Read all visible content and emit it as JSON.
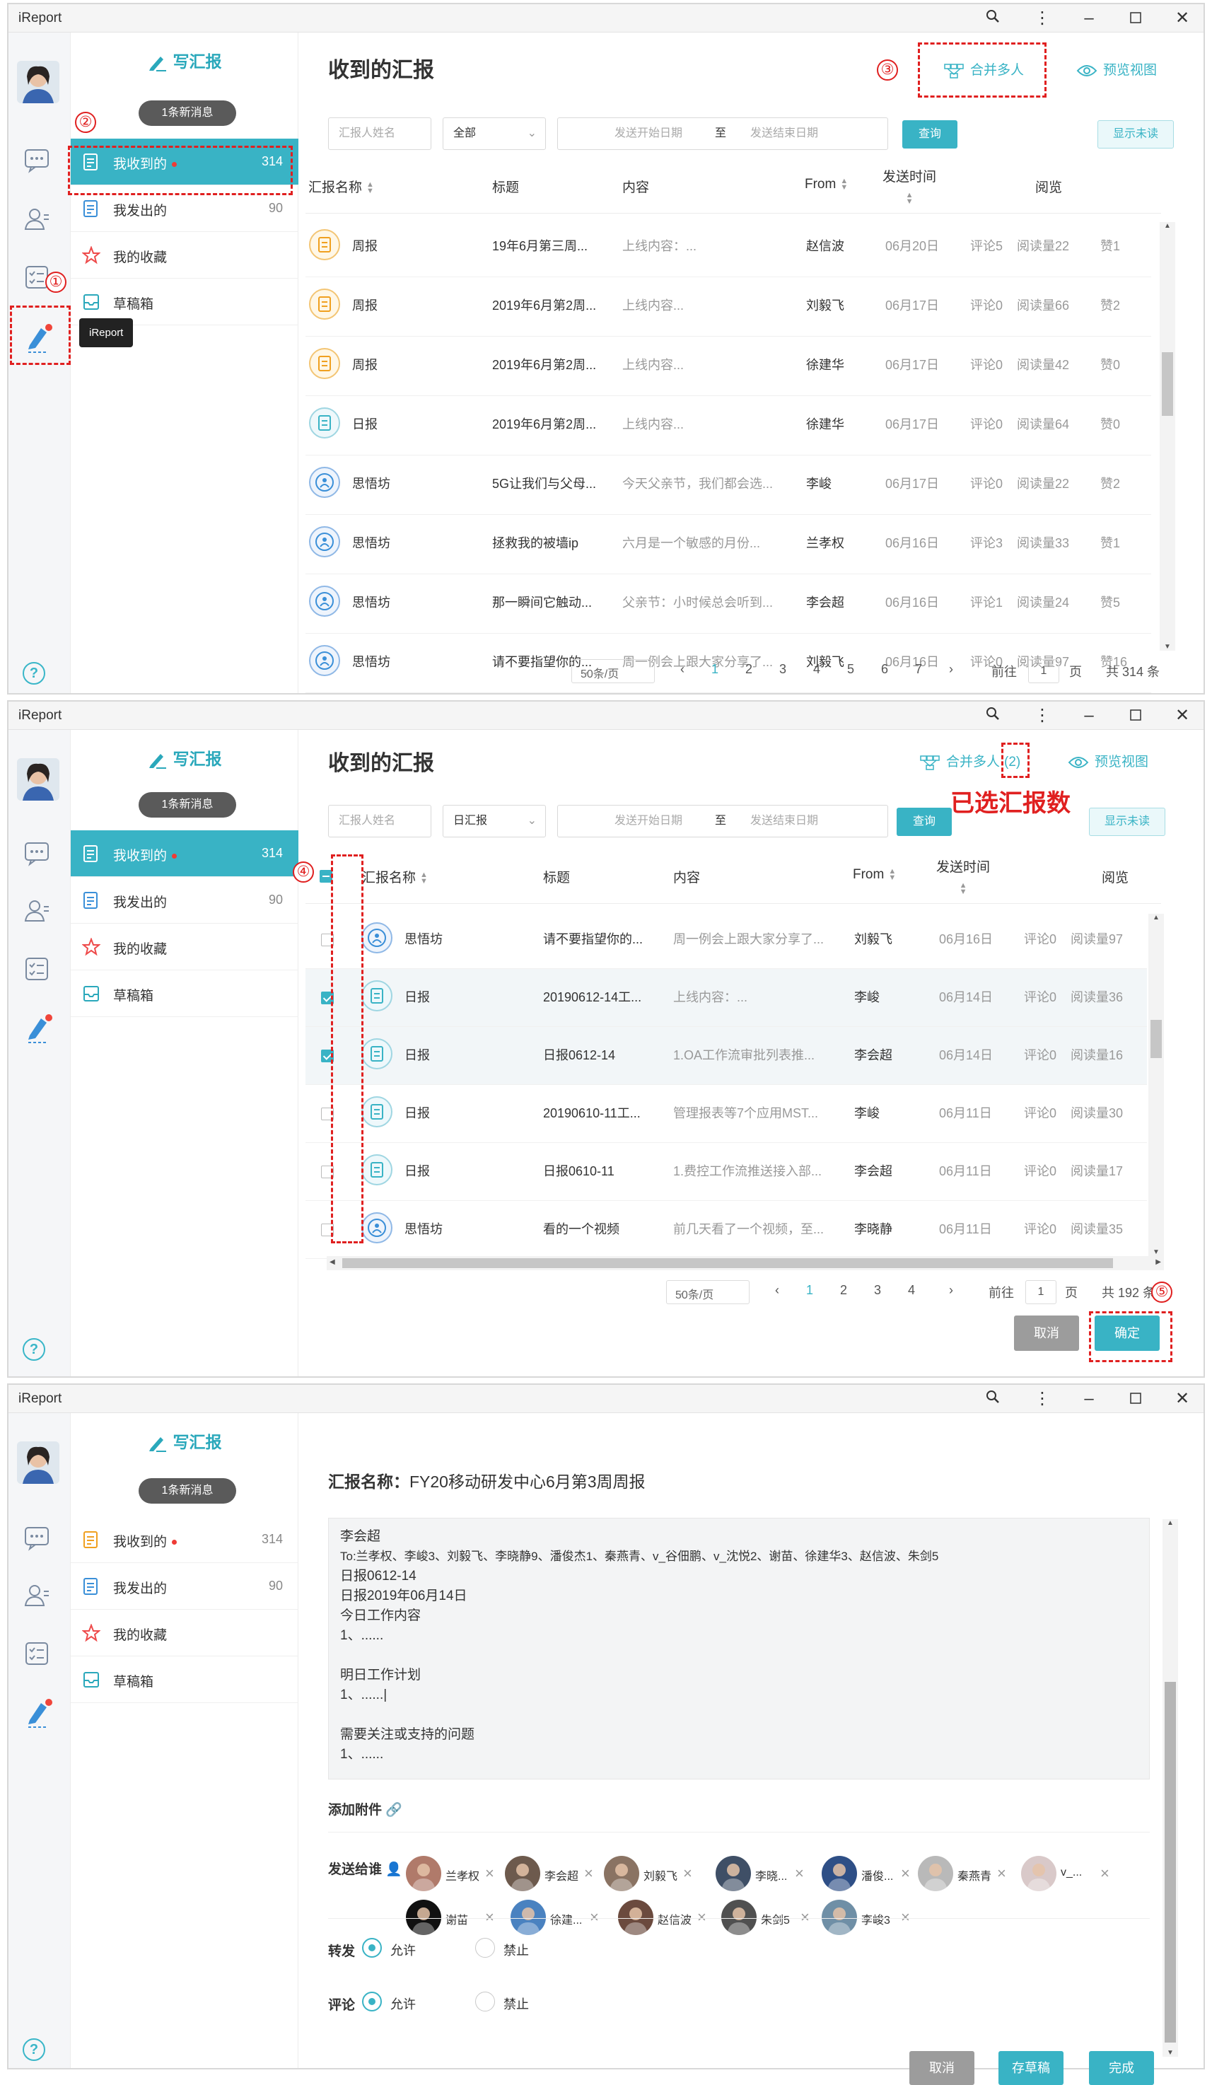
{
  "app": {
    "title": "iReport"
  },
  "sidebar": {
    "write_label": "写汇报",
    "new_msg": "1条新消息",
    "items": [
      {
        "label": "我收到的",
        "count": "314"
      },
      {
        "label": "我发出的",
        "count": "90"
      },
      {
        "label": "我的收藏"
      },
      {
        "label": "草稿箱"
      }
    ]
  },
  "tooltip": "iReport",
  "icons": {
    "chat": "chat-bubble-icon",
    "contacts": "contacts-icon",
    "tasks": "task-list-icon",
    "report": "pen-icon",
    "help": "?"
  },
  "main": {
    "title": "收到的汇报",
    "merge_label": "合并多人",
    "merge_count": "(2)",
    "preview_label": "预览视图",
    "filter": {
      "name_placeholder": "汇报人姓名",
      "type_all": "全部",
      "type_daily": "日汇报",
      "date_start": "发送开始日期",
      "date_to": "至",
      "date_end": "发送结束日期",
      "query": "查询",
      "unread": "显示未读"
    },
    "columns": {
      "name": "汇报名称",
      "title": "标题",
      "content": "内容",
      "from": "From",
      "time1": "发送时间",
      "read": "阅览"
    }
  },
  "table1": [
    {
      "type": "周报",
      "icon": "weekly",
      "title": "19年6月第三周...",
      "content": "上线内容：...",
      "from": "赵信波",
      "date": "06月20日",
      "cmt": "评论5",
      "views": "阅读量22",
      "likes": "赞1"
    },
    {
      "type": "周报",
      "icon": "weekly",
      "title": "2019年6月第2周...",
      "content": "上线内容...",
      "from": "刘毅飞",
      "date": "06月17日",
      "cmt": "评论0",
      "views": "阅读量66",
      "likes": "赞2"
    },
    {
      "type": "周报",
      "icon": "weekly",
      "title": "2019年6月第2周...",
      "content": "上线内容...",
      "from": "徐建华",
      "date": "06月17日",
      "cmt": "评论0",
      "views": "阅读量42",
      "likes": "赞0"
    },
    {
      "type": "日报",
      "icon": "daily",
      "title": "2019年6月第2周...",
      "content": "上线内容...",
      "from": "徐建华",
      "date": "06月17日",
      "cmt": "评论0",
      "views": "阅读量64",
      "likes": "赞0"
    },
    {
      "type": "思悟坊",
      "icon": "think",
      "title": "5G让我们与父母...",
      "content": "今天父亲节，我们都会选...",
      "from": "李峻",
      "date": "06月17日",
      "cmt": "评论0",
      "views": "阅读量22",
      "likes": "赞2"
    },
    {
      "type": "思悟坊",
      "icon": "think",
      "title": "拯救我的被墙ip",
      "content": "六月是一个敏感的月份...",
      "from": "兰孝权",
      "date": "06月16日",
      "cmt": "评论3",
      "views": "阅读量33",
      "likes": "赞1"
    },
    {
      "type": "思悟坊",
      "icon": "think",
      "title": "那一瞬间它触动...",
      "content": "父亲节：小时候总会听到...",
      "from": "李会超",
      "date": "06月16日",
      "cmt": "评论1",
      "views": "阅读量24",
      "likes": "赞5"
    },
    {
      "type": "思悟坊",
      "icon": "think",
      "title": "请不要指望你的...",
      "content": "周一例会上跟大家分享了...",
      "from": "刘毅飞",
      "date": "06月16日",
      "cmt": "评论0",
      "views": "阅读量97",
      "likes": "赞16"
    }
  ],
  "table2": [
    {
      "type": "思悟坊",
      "icon": "think",
      "title": "请不要指望你的...",
      "content": "周一例会上跟大家分享了...",
      "from": "刘毅飞",
      "date": "06月16日",
      "cmt": "评论0",
      "views": "阅读量97",
      "checked": false
    },
    {
      "type": "日报",
      "icon": "daily",
      "title": "20190612-14工...",
      "content": "上线内容：...",
      "from": "李峻",
      "date": "06月14日",
      "cmt": "评论0",
      "views": "阅读量36",
      "checked": true
    },
    {
      "type": "日报",
      "icon": "daily",
      "title": "日报0612-14",
      "content": "1.OA工作流审批列表推...",
      "from": "李会超",
      "date": "06月14日",
      "cmt": "评论0",
      "views": "阅读量16",
      "checked": true
    },
    {
      "type": "日报",
      "icon": "daily",
      "title": "20190610-11工...",
      "content": "管理报表等7个应用MST...",
      "from": "李峻",
      "date": "06月11日",
      "cmt": "评论0",
      "views": "阅读量30",
      "checked": false
    },
    {
      "type": "日报",
      "icon": "daily",
      "title": "日报0610-11",
      "content": "1.费控工作流推送接入部...",
      "from": "李会超",
      "date": "06月11日",
      "cmt": "评论0",
      "views": "阅读量17",
      "checked": false
    },
    {
      "type": "思悟坊",
      "icon": "think",
      "title": "看的一个视频",
      "content": "前几天看了一个视频，至...",
      "from": "李晓静",
      "date": "06月11日",
      "cmt": "评论0",
      "views": "阅读量35",
      "checked": false
    }
  ],
  "pager1": {
    "size": "50条/页",
    "pages": [
      "1",
      "2",
      "3",
      "4",
      "5",
      "6",
      "7"
    ],
    "goto": "前往",
    "page": "1",
    "unit": "页",
    "total": "共 314 条",
    "prev": "‹",
    "next": "›"
  },
  "pager2": {
    "size": "50条/页",
    "pages": [
      "1",
      "2",
      "3",
      "4"
    ],
    "goto": "前往",
    "page": "1",
    "unit": "页",
    "total": "共 192 条",
    "prev": "‹",
    "next": "›"
  },
  "actions": {
    "cancel": "取消",
    "confirm": "确定",
    "draft": "存草稿",
    "done": "完成"
  },
  "annotations": {
    "n1": "①",
    "n2": "②",
    "n3": "③",
    "n4": "④",
    "n5": "⑤",
    "selected": "已选汇报数"
  },
  "compose": {
    "name_label": "汇报名称：",
    "name_value": "FY20移动研发中心6月第3周周报",
    "body": [
      "李会超",
      "To:兰孝权、李峻3、刘毅飞、李晓静9、潘俊杰1、秦燕青、v_谷佃鹏、v_沈悦2、谢苗、徐建华3、赵信波、朱剑5",
      "日报0612-14",
      "日报2019年06月14日",
      "今日工作内容",
      "1、......",
      "",
      "明日工作计划",
      "1、......|",
      "",
      "需要关注或支持的问题",
      "1、......"
    ],
    "attach_label": "添加附件",
    "send_label": "发送给谁",
    "recipients": [
      {
        "name": "兰孝权",
        "color": "#b07a6a"
      },
      {
        "name": "李会超",
        "color": "#6d5a4d"
      },
      {
        "name": "刘毅飞",
        "color": "#8a7363"
      },
      {
        "name": "李晓...",
        "color": "#3f4f66"
      },
      {
        "name": "潘俊...",
        "color": "#2e4f86"
      },
      {
        "name": "秦燕青",
        "color": "#b9b9b9"
      },
      {
        "name": "v_...",
        "color": "#d9c9c9"
      },
      {
        "name": "谢苗",
        "color": "#111111"
      },
      {
        "name": "徐建...",
        "color": "#4a82c0"
      },
      {
        "name": "赵信波",
        "color": "#6b4a3e"
      },
      {
        "name": "朱剑5",
        "color": "#505050"
      },
      {
        "name": "李峻3",
        "color": "#6f8fa6"
      }
    ],
    "forward_label": "转发",
    "comment_label": "评论",
    "allow": "允许",
    "deny": "禁止"
  }
}
